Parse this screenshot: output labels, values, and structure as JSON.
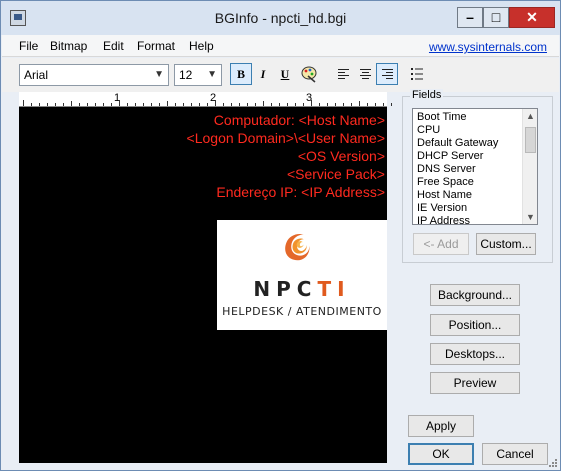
{
  "window": {
    "title": "BGInfo - npcti_hd.bgi",
    "controls": {
      "minimize": "–",
      "maximize": "□",
      "close": "✕"
    }
  },
  "menu": {
    "items": [
      "File",
      "Bitmap",
      "Edit",
      "Format",
      "Help"
    ],
    "link": "www.sysinternals.com"
  },
  "toolbar": {
    "font_name": "Arial",
    "font_size": "12",
    "bold_label": "B",
    "italic_label": "I",
    "underline_label": "U",
    "align_selected": "right"
  },
  "ruler": {
    "labels": [
      "1",
      "2",
      "3"
    ]
  },
  "preview": {
    "background_color": "#000000",
    "text_color": "#ff2a1f",
    "lines": [
      "Computador: <Host Name>",
      "<Logon Domain>\\<User Name>",
      "<OS Version>",
      "<Service Pack>",
      "Endereço IP: <IP Address>"
    ],
    "logo": {
      "name_prefix": "NPC",
      "name_suffix": "TI",
      "tagline": "HELPDESK / ATENDIMENTO"
    }
  },
  "fields": {
    "label": "Fields",
    "items": [
      "Boot Time",
      "CPU",
      "Default Gateway",
      "DHCP Server",
      "DNS Server",
      "Free Space",
      "Host Name",
      "IE Version",
      "IP Address"
    ],
    "add_button": "<- Add",
    "custom_button": "Custom..."
  },
  "buttons": {
    "background": "Background...",
    "position": "Position...",
    "desktops": "Desktops...",
    "preview": "Preview",
    "apply": "Apply",
    "ok": "OK",
    "cancel": "Cancel"
  }
}
